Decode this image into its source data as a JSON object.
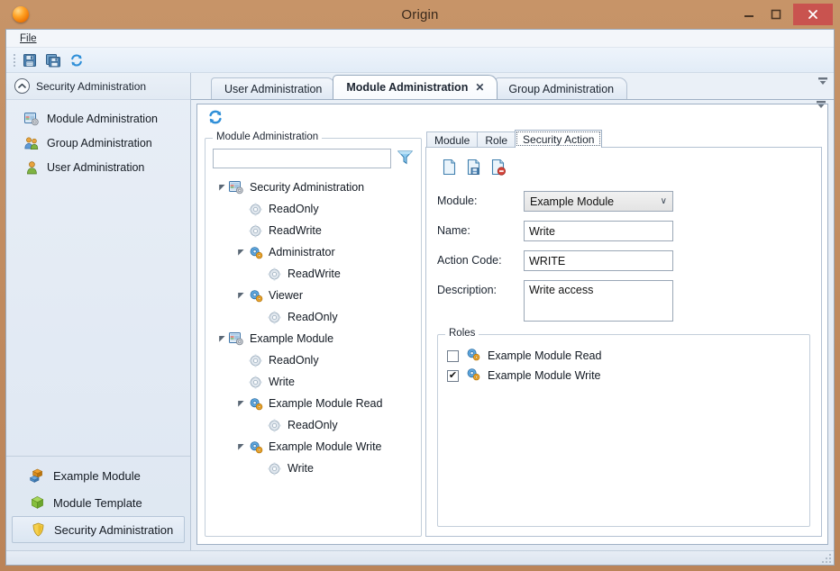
{
  "window": {
    "title": "Origin",
    "app_icon": "origin-sphere-icon",
    "minimize_label": "Minimize",
    "maximize_label": "Maximize",
    "close_label": "Close"
  },
  "menubar": {
    "items": [
      {
        "label": "File",
        "accel": "F"
      }
    ]
  },
  "toolbar": {
    "buttons": [
      {
        "name": "save-button",
        "icon": "floppy-disk-icon",
        "tooltip": "Save"
      },
      {
        "name": "save-all-button",
        "icon": "save-all-icon",
        "tooltip": "Save All"
      },
      {
        "name": "refresh-button",
        "icon": "refresh-icon",
        "tooltip": "Refresh"
      }
    ]
  },
  "sidebar": {
    "header": {
      "title": "Security Administration",
      "collapse_icon": "chevron-up-circle-icon"
    },
    "items": [
      {
        "label": "Module Administration",
        "icon": "module-admin-icon"
      },
      {
        "label": "Group Administration",
        "icon": "group-admin-icon"
      },
      {
        "label": "User Administration",
        "icon": "user-admin-icon"
      }
    ],
    "bottom_buttons": [
      {
        "label": "Example Module",
        "icon": "example-module-icon",
        "active": false
      },
      {
        "label": "Module Template",
        "icon": "module-template-icon",
        "active": false
      },
      {
        "label": "Security Administration",
        "icon": "shield-icon",
        "active": true
      }
    ]
  },
  "doc_tabs": [
    {
      "label": "User Administration",
      "active": false,
      "closable": false
    },
    {
      "label": "Module Administration",
      "active": true,
      "closable": true,
      "close_glyph": "✕"
    },
    {
      "label": "Group Administration",
      "active": false,
      "closable": false
    }
  ],
  "doc_toolbar": {
    "buttons": [
      {
        "name": "refresh-button",
        "icon": "refresh-icon",
        "tooltip": "Refresh"
      }
    ]
  },
  "tree_panel": {
    "legend": "Module Administration",
    "search": {
      "value": "",
      "placeholder": ""
    },
    "filter_icon": "funnel-filter-icon",
    "nodes": [
      {
        "label": "Security Administration",
        "depth": 0,
        "icon": "module-icon",
        "expander": "expanded"
      },
      {
        "label": "ReadOnly",
        "depth": 1,
        "icon": "action-icon",
        "expander": "none"
      },
      {
        "label": "ReadWrite",
        "depth": 1,
        "icon": "action-icon",
        "expander": "none"
      },
      {
        "label": "Administrator",
        "depth": 1,
        "icon": "role-icon",
        "expander": "expanded"
      },
      {
        "label": "ReadWrite",
        "depth": 2,
        "icon": "action-icon",
        "expander": "none"
      },
      {
        "label": "Viewer",
        "depth": 1,
        "icon": "role-icon",
        "expander": "expanded"
      },
      {
        "label": "ReadOnly",
        "depth": 2,
        "icon": "action-icon",
        "expander": "none"
      },
      {
        "label": "Example Module",
        "depth": 0,
        "icon": "module-icon",
        "expander": "expanded"
      },
      {
        "label": "ReadOnly",
        "depth": 1,
        "icon": "action-icon",
        "expander": "none"
      },
      {
        "label": "Write",
        "depth": 1,
        "icon": "action-icon",
        "expander": "none"
      },
      {
        "label": "Example Module Read",
        "depth": 1,
        "icon": "role-icon",
        "expander": "expanded"
      },
      {
        "label": "ReadOnly",
        "depth": 2,
        "icon": "action-icon",
        "expander": "none"
      },
      {
        "label": "Example Module Write",
        "depth": 1,
        "icon": "role-icon",
        "expander": "expanded"
      },
      {
        "label": "Write",
        "depth": 2,
        "icon": "action-icon",
        "expander": "none"
      }
    ]
  },
  "detail_panel": {
    "tabs": [
      {
        "label": "Module",
        "active": false
      },
      {
        "label": "Role",
        "active": false
      },
      {
        "label": "Security Action",
        "active": true
      }
    ],
    "toolbar": [
      {
        "name": "new-button",
        "icon": "new-document-icon",
        "tooltip": "New"
      },
      {
        "name": "save-button",
        "icon": "save-document-icon",
        "tooltip": "Save"
      },
      {
        "name": "delete-button",
        "icon": "delete-document-icon",
        "tooltip": "Delete"
      }
    ],
    "form": {
      "module": {
        "label": "Module:",
        "value": "Example Module",
        "type": "select",
        "chevron": "∨"
      },
      "name": {
        "label": "Name:",
        "value": "Write",
        "type": "text"
      },
      "action_code": {
        "label": "Action Code:",
        "value": "WRITE",
        "type": "text"
      },
      "description": {
        "label": "Description:",
        "value": "Write access",
        "type": "textarea"
      }
    },
    "roles": {
      "legend": "Roles",
      "items": [
        {
          "label": "Example Module Read",
          "checked": false,
          "icon": "role-icon",
          "check_glyph": ""
        },
        {
          "label": "Example Module Write",
          "checked": true,
          "icon": "role-icon",
          "check_glyph": "✔"
        }
      ]
    }
  },
  "colors": {
    "titlebar": "#c08a5e",
    "close_button": "#c9534f",
    "accent_blue": "#2f8fd8",
    "panel_bg": "#e8eef6"
  }
}
